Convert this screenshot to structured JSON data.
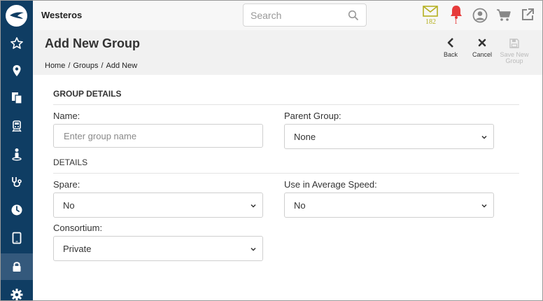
{
  "app": {
    "title": "Westeros"
  },
  "search": {
    "placeholder": "Search"
  },
  "notifications": {
    "mail_count": "182",
    "alert_count": "1"
  },
  "colors": {
    "sidebar": "#0f3d63",
    "sidebar_active": "#34597c",
    "mail": "#b5b020",
    "alert": "#e63b3b"
  },
  "sidebar": {
    "items": [
      {
        "icon": "star-icon"
      },
      {
        "icon": "map-pin-icon"
      },
      {
        "icon": "documents-icon"
      },
      {
        "icon": "train-icon"
      },
      {
        "icon": "person-pin-icon"
      },
      {
        "icon": "stethoscope-icon"
      },
      {
        "icon": "clock-icon"
      },
      {
        "icon": "tablet-icon"
      },
      {
        "icon": "lock-icon",
        "active": true
      },
      {
        "icon": "gear-icon"
      }
    ]
  },
  "page": {
    "title": "Add New Group",
    "breadcrumb": [
      "Home",
      "/",
      "Groups",
      "/",
      "Add New"
    ]
  },
  "actions": {
    "back": "Back",
    "cancel": "Cancel",
    "save_line1": "Save New",
    "save_line2": "Group"
  },
  "form": {
    "group_details_heading": "GROUP DETAILS",
    "name_label": "Name:",
    "name_placeholder": "Enter group name",
    "name_value": "",
    "parent_group_label": "Parent Group:",
    "parent_group_value": "None",
    "details_heading": "DETAILS",
    "spare_label": "Spare:",
    "spare_value": "No",
    "avg_speed_label": "Use in Average Speed:",
    "avg_speed_value": "No",
    "consortium_label": "Consortium:",
    "consortium_value": "Private"
  }
}
